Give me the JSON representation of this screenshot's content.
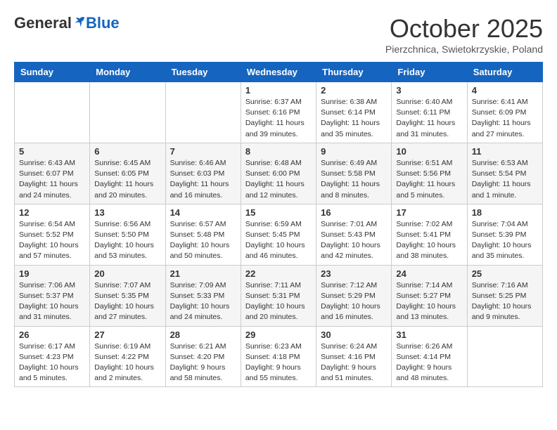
{
  "header": {
    "logo_general": "General",
    "logo_blue": "Blue",
    "month_title": "October 2025",
    "location": "Pierzchnica, Swietokrzyskie, Poland"
  },
  "days_of_week": [
    "Sunday",
    "Monday",
    "Tuesday",
    "Wednesday",
    "Thursday",
    "Friday",
    "Saturday"
  ],
  "weeks": [
    [
      {
        "day": "",
        "content": ""
      },
      {
        "day": "",
        "content": ""
      },
      {
        "day": "",
        "content": ""
      },
      {
        "day": "1",
        "content": "Sunrise: 6:37 AM\nSunset: 6:16 PM\nDaylight: 11 hours\nand 39 minutes."
      },
      {
        "day": "2",
        "content": "Sunrise: 6:38 AM\nSunset: 6:14 PM\nDaylight: 11 hours\nand 35 minutes."
      },
      {
        "day": "3",
        "content": "Sunrise: 6:40 AM\nSunset: 6:11 PM\nDaylight: 11 hours\nand 31 minutes."
      },
      {
        "day": "4",
        "content": "Sunrise: 6:41 AM\nSunset: 6:09 PM\nDaylight: 11 hours\nand 27 minutes."
      }
    ],
    [
      {
        "day": "5",
        "content": "Sunrise: 6:43 AM\nSunset: 6:07 PM\nDaylight: 11 hours\nand 24 minutes."
      },
      {
        "day": "6",
        "content": "Sunrise: 6:45 AM\nSunset: 6:05 PM\nDaylight: 11 hours\nand 20 minutes."
      },
      {
        "day": "7",
        "content": "Sunrise: 6:46 AM\nSunset: 6:03 PM\nDaylight: 11 hours\nand 16 minutes."
      },
      {
        "day": "8",
        "content": "Sunrise: 6:48 AM\nSunset: 6:00 PM\nDaylight: 11 hours\nand 12 minutes."
      },
      {
        "day": "9",
        "content": "Sunrise: 6:49 AM\nSunset: 5:58 PM\nDaylight: 11 hours\nand 8 minutes."
      },
      {
        "day": "10",
        "content": "Sunrise: 6:51 AM\nSunset: 5:56 PM\nDaylight: 11 hours\nand 5 minutes."
      },
      {
        "day": "11",
        "content": "Sunrise: 6:53 AM\nSunset: 5:54 PM\nDaylight: 11 hours\nand 1 minute."
      }
    ],
    [
      {
        "day": "12",
        "content": "Sunrise: 6:54 AM\nSunset: 5:52 PM\nDaylight: 10 hours\nand 57 minutes."
      },
      {
        "day": "13",
        "content": "Sunrise: 6:56 AM\nSunset: 5:50 PM\nDaylight: 10 hours\nand 53 minutes."
      },
      {
        "day": "14",
        "content": "Sunrise: 6:57 AM\nSunset: 5:48 PM\nDaylight: 10 hours\nand 50 minutes."
      },
      {
        "day": "15",
        "content": "Sunrise: 6:59 AM\nSunset: 5:45 PM\nDaylight: 10 hours\nand 46 minutes."
      },
      {
        "day": "16",
        "content": "Sunrise: 7:01 AM\nSunset: 5:43 PM\nDaylight: 10 hours\nand 42 minutes."
      },
      {
        "day": "17",
        "content": "Sunrise: 7:02 AM\nSunset: 5:41 PM\nDaylight: 10 hours\nand 38 minutes."
      },
      {
        "day": "18",
        "content": "Sunrise: 7:04 AM\nSunset: 5:39 PM\nDaylight: 10 hours\nand 35 minutes."
      }
    ],
    [
      {
        "day": "19",
        "content": "Sunrise: 7:06 AM\nSunset: 5:37 PM\nDaylight: 10 hours\nand 31 minutes."
      },
      {
        "day": "20",
        "content": "Sunrise: 7:07 AM\nSunset: 5:35 PM\nDaylight: 10 hours\nand 27 minutes."
      },
      {
        "day": "21",
        "content": "Sunrise: 7:09 AM\nSunset: 5:33 PM\nDaylight: 10 hours\nand 24 minutes."
      },
      {
        "day": "22",
        "content": "Sunrise: 7:11 AM\nSunset: 5:31 PM\nDaylight: 10 hours\nand 20 minutes."
      },
      {
        "day": "23",
        "content": "Sunrise: 7:12 AM\nSunset: 5:29 PM\nDaylight: 10 hours\nand 16 minutes."
      },
      {
        "day": "24",
        "content": "Sunrise: 7:14 AM\nSunset: 5:27 PM\nDaylight: 10 hours\nand 13 minutes."
      },
      {
        "day": "25",
        "content": "Sunrise: 7:16 AM\nSunset: 5:25 PM\nDaylight: 10 hours\nand 9 minutes."
      }
    ],
    [
      {
        "day": "26",
        "content": "Sunrise: 6:17 AM\nSunset: 4:23 PM\nDaylight: 10 hours\nand 5 minutes."
      },
      {
        "day": "27",
        "content": "Sunrise: 6:19 AM\nSunset: 4:22 PM\nDaylight: 10 hours\nand 2 minutes."
      },
      {
        "day": "28",
        "content": "Sunrise: 6:21 AM\nSunset: 4:20 PM\nDaylight: 9 hours\nand 58 minutes."
      },
      {
        "day": "29",
        "content": "Sunrise: 6:23 AM\nSunset: 4:18 PM\nDaylight: 9 hours\nand 55 minutes."
      },
      {
        "day": "30",
        "content": "Sunrise: 6:24 AM\nSunset: 4:16 PM\nDaylight: 9 hours\nand 51 minutes."
      },
      {
        "day": "31",
        "content": "Sunrise: 6:26 AM\nSunset: 4:14 PM\nDaylight: 9 hours\nand 48 minutes."
      },
      {
        "day": "",
        "content": ""
      }
    ]
  ]
}
